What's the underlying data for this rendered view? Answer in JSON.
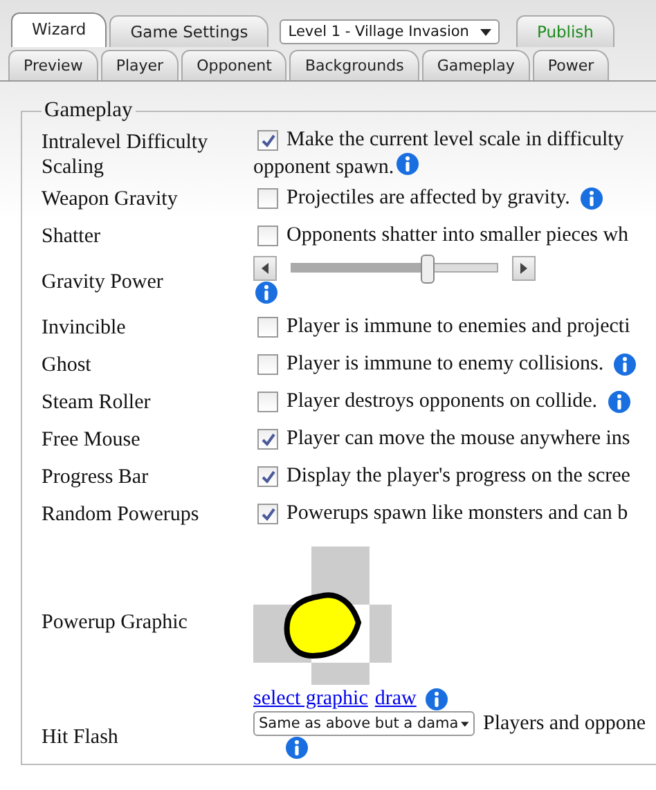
{
  "top_tabs": [
    {
      "kind": "tab",
      "label": "Wizard",
      "selected": true
    },
    {
      "kind": "tab",
      "label": "Game Settings",
      "selected": false
    },
    {
      "kind": "select",
      "label": "Level 1 - Village Invasion"
    },
    {
      "kind": "publish",
      "label": "Publish",
      "selected": false
    }
  ],
  "sub_tabs": [
    {
      "label": "Preview",
      "selected": false
    },
    {
      "label": "Player",
      "selected": false
    },
    {
      "label": "Opponent",
      "selected": false
    },
    {
      "label": "Backgrounds",
      "selected": false
    },
    {
      "label": "Gameplay",
      "selected": false
    },
    {
      "label": "Power",
      "selected": false
    }
  ],
  "section": {
    "legend": "Gameplay",
    "rows": [
      {
        "kind": "checkbox",
        "label": "Intralevel Difficulty Scaling",
        "checked": true,
        "text": "Make the current level scale in difficulty",
        "text_continued": "opponent spawn.",
        "info": true
      },
      {
        "kind": "checkbox",
        "label": "Weapon Gravity",
        "checked": false,
        "text": "Projectiles are affected by gravity.",
        "info": true
      },
      {
        "kind": "checkbox",
        "label": "Shatter",
        "checked": false,
        "text": "Opponents shatter into smaller pieces wh"
      },
      {
        "kind": "slider",
        "label": "Gravity Power",
        "level": 0.66,
        "info": true
      },
      {
        "kind": "checkbox",
        "label": "Invincible",
        "checked": false,
        "text": "Player is immune to enemies and projecti"
      },
      {
        "kind": "checkbox",
        "label": "Ghost",
        "checked": false,
        "text": "Player is immune to enemy collisions.",
        "info": true
      },
      {
        "kind": "checkbox",
        "label": "Steam Roller",
        "checked": false,
        "text": "Player destroys opponents on collide.",
        "info": true
      },
      {
        "kind": "checkbox",
        "label": "Free Mouse",
        "checked": true,
        "text": "Player can move the mouse anywhere ins"
      },
      {
        "kind": "checkbox",
        "label": "Progress Bar",
        "checked": true,
        "text": "Display the player's progress on the scree"
      },
      {
        "kind": "checkbox",
        "label": "Random Powerups",
        "checked": true,
        "text": "Powerups spawn like monsters and can b"
      },
      {
        "kind": "graphic",
        "label": "Powerup Graphic",
        "links": [
          "select graphic",
          "draw"
        ],
        "info": true
      },
      {
        "kind": "dropdown",
        "label": "Hit Flash",
        "value": "Same as above but a dama",
        "text": "Players and oppone",
        "info": true
      }
    ]
  }
}
